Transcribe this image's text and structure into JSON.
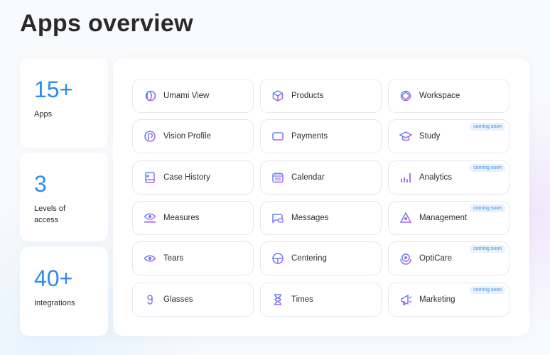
{
  "title": "Apps overview",
  "stats": [
    {
      "value": "15+",
      "label": "Apps"
    },
    {
      "value": "3",
      "label": "Levels of access"
    },
    {
      "value": "40+",
      "label": "Integrations"
    }
  ],
  "badge_text": "coming soon",
  "colors": {
    "accent": "#2d8cf0",
    "icon_from": "#c05ce8",
    "icon_to": "#4a8cf5"
  },
  "apps": [
    {
      "name": "Umami View",
      "icon": "umami-icon",
      "soon": false
    },
    {
      "name": "Products",
      "icon": "box-icon",
      "soon": false
    },
    {
      "name": "Workspace",
      "icon": "workspace-icon",
      "soon": false
    },
    {
      "name": "Vision Profile",
      "icon": "vision-profile-icon",
      "soon": false
    },
    {
      "name": "Payments",
      "icon": "credit-card-icon",
      "soon": false
    },
    {
      "name": "Study",
      "icon": "graduation-cap-icon",
      "soon": true
    },
    {
      "name": "Case History",
      "icon": "book-icon",
      "soon": false
    },
    {
      "name": "Calendar",
      "icon": "calendar-icon",
      "soon": false
    },
    {
      "name": "Analytics",
      "icon": "bar-chart-icon",
      "soon": true
    },
    {
      "name": "Measures",
      "icon": "eye-ruler-icon",
      "soon": false
    },
    {
      "name": "Messages",
      "icon": "message-icon",
      "soon": false
    },
    {
      "name": "Management",
      "icon": "network-icon",
      "soon": true
    },
    {
      "name": "Tears",
      "icon": "eye-drop-icon",
      "soon": false
    },
    {
      "name": "Centering",
      "icon": "centering-icon",
      "soon": false
    },
    {
      "name": "OptiCare",
      "icon": "opticare-icon",
      "soon": true
    },
    {
      "name": "Glasses",
      "icon": "glasses-icon",
      "soon": false
    },
    {
      "name": "Times",
      "icon": "hourglass-icon",
      "soon": false
    },
    {
      "name": "Marketing",
      "icon": "megaphone-icon",
      "soon": true
    }
  ]
}
